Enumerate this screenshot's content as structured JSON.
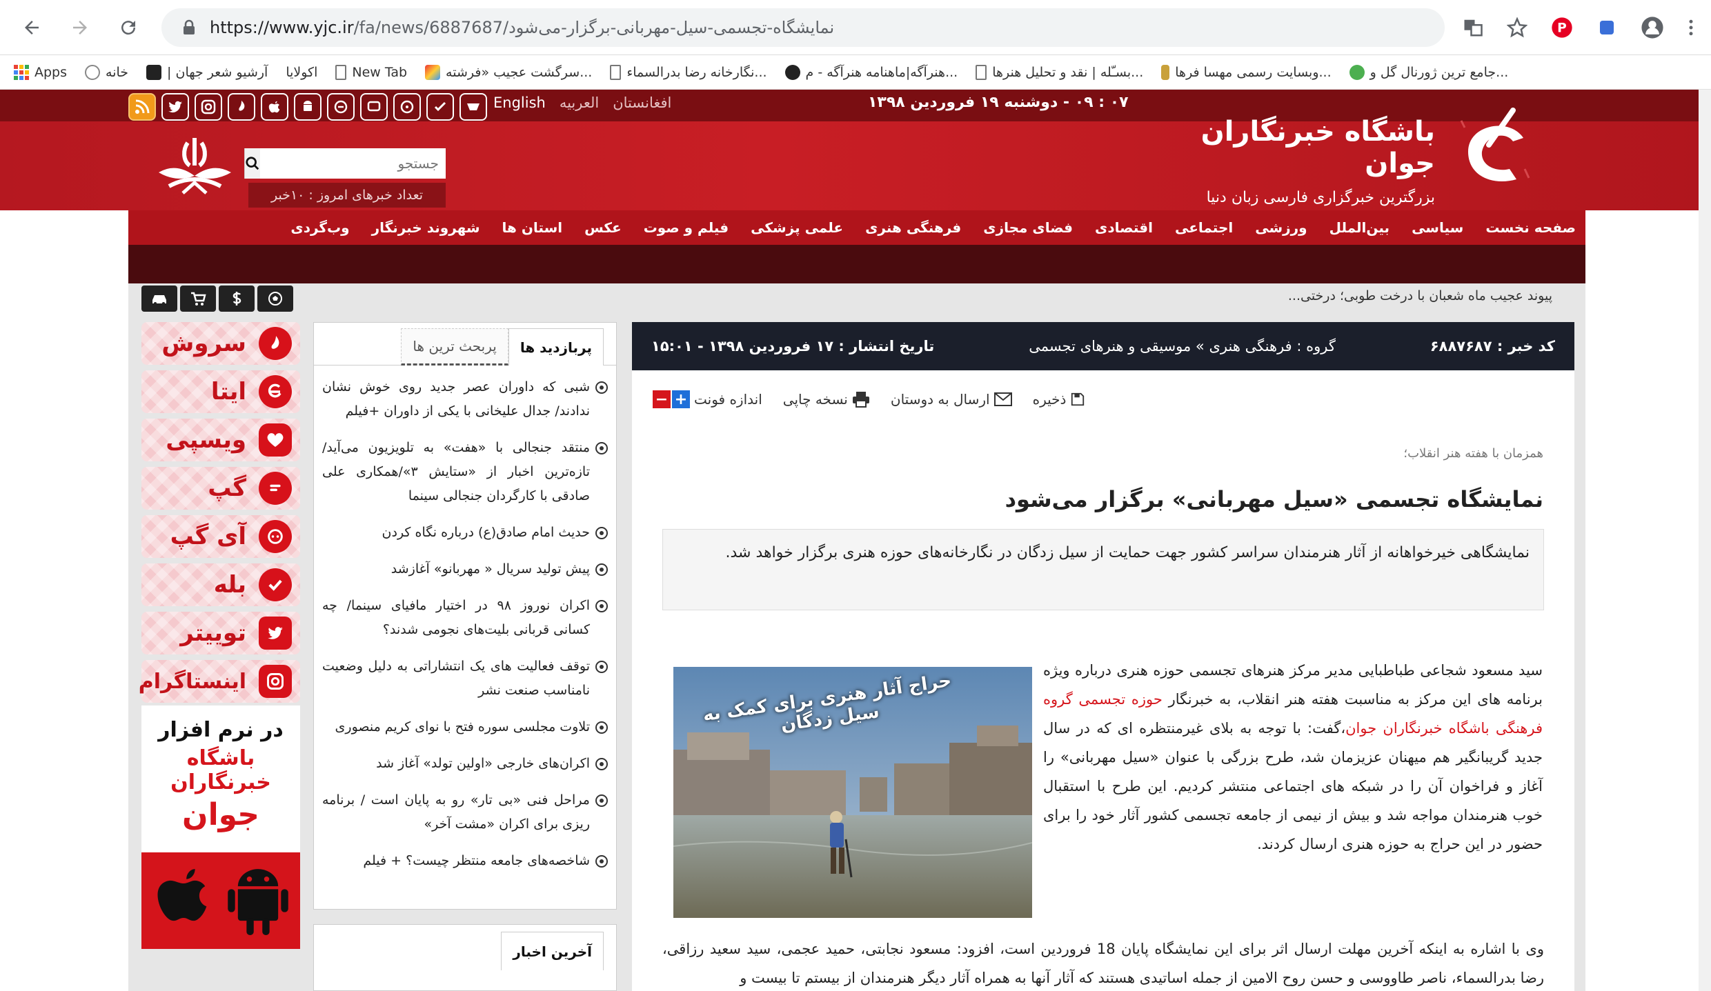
{
  "browser": {
    "url": "https://www.yjc.ir/fa/news/6887687/نمایشگاه-تجسمی-سیل-مهربانی-برگزار-می‌شود",
    "url_host": "https://www.yjc.ir",
    "url_path": "/fa/news/6887687/نمایشگاه-تجسمی-سیل-مهربانی-برگزار-می‌شود"
  },
  "bookmarks": [
    "Apps",
    "خانه",
    "| آرشیو شعر جهان",
    "اکولایا",
    "New Tab",
    "سرگشت عجیب «فرشته...",
    "نگارخانه رضا بدرالسماء...",
    "هنرآگه|ماهنامه هنرآگه - م...",
    "بسـّله | نقد و تحلیل هنرها...",
    "وبسایت رسمی مهسا فرها...",
    "جامع ترین ژورنال گل و..."
  ],
  "site": {
    "date": "۰۷ : ۰۹ - دوشنبه ۱۹ فروردین ۱۳۹۸",
    "langs": [
      "افغانستان",
      "العربیه",
      "English"
    ],
    "social": [
      "W",
      "E",
      "P",
      "E",
      "E",
      "A",
      "",
      "S",
      "",
      "T",
      "RSS"
    ],
    "title": "باشگاه خبرنگاران جوان",
    "slogan": "بزرگترین خبرگزاری فارسی زبان دنیا",
    "search_placeholder": "جستجو",
    "news_count": "تعداد خبرهای امروز : ۱۰خبر",
    "menu": [
      "صفحه نخست",
      "سیاسی",
      "بین‌الملل",
      "ورزشی",
      "اجتماعی",
      "اقتصادی",
      "فضای مجازی",
      "فرهنگی هنری",
      "علمی پزشکی",
      "فیلم و صوت",
      "عکس",
      "استان ها",
      "شهروند خبرنگار",
      "وب‌گردی"
    ],
    "ticker": "پیوند عجیب ماه شعبان با درخت طوبی؛ درختی..."
  },
  "article": {
    "code": "کد خبر : ۶۸۸۷۶۸۷",
    "group": "گروه : فرهنگی هنری » موسیقی و هنرهای تجسمی",
    "published": "تاریخ انتشار : ۱۷ فروردین ۱۳۹۸ - ۱۵:۰۱",
    "tools": {
      "save": "ذخیره",
      "send": "ارسال به دوستان",
      "print": "نسخه چاپی",
      "fontsize": "اندازه فونت",
      "minus": "−",
      "plus": "+"
    },
    "overline": "همزمان با هفته هنر انقلاب؛",
    "headline": "نمایشگاه تجسمی «سیل مهربانی» برگزار می‌شود",
    "lead": "نمایشگاهی خیرخواهانه از آثار هنرمندان سراسر کشور جهت حمایت از سیل زدگان در نگارخانه‌های حوزه هنری برگزار خواهد شد.",
    "photo_caption": "حراج آثار هنری برای کمک به سیل زدگان",
    "body1_a": "سید مسعود شجاعی طباطبایی مدیر مرکز هنرهای تجسمی حوزه هنری درباره ویژه برنامه های این مرکز به مناسبت هفته هنر انقلاب، به خبرنگار ",
    "body1_link": "حوزه تجسمی گروه فرهنگی باشگاه خبرنگاران جوان",
    "body1_b": "،گفت: با توجه به بلای غیرمنتظره ای که در سال جدید گریبانگیر هم میهنان عزیزمان شد، طرح بزرگی با عنوان «سیل مهربانی» را آغاز و فراخوان آن را در شبکه های اجتماعی منتشر کردیم. این طرح با استقبال خوب هنرمندان مواجه شد و بیش از نیمی از جامعه تجسمی کشور آثار خود را برای حضور در این حراج به حوزه هنری ارسال کردند.",
    "body2": "وی با اشاره به اینکه آخرین مهلت ارسال اثر برای این نمایشگاه پایان 18 فروردین است، افزود: مسعود نجابتی، حمید عجمی، سید سعید رزاقی، رضا بدرالسماء، ناصر طاووسی و حسن روح الامین از جمله اساتیدی هستند که آثار آنها به همراه آثار دیگر هنرمندان از بیستم تا بیست و"
  },
  "sidebar": {
    "tab_active": "پربازدید ها",
    "tab_inactive": "پربحث ترین ها",
    "items": [
      "شبی که داوران عصر جدید روی خوش نشان ندادند/ جدال علیخانی با یکی از داوران +فیلم",
      "منتقد جنجالی با «هفت» به تلویزیون می‌آید/ تازه‌ترین اخبار از «ستایش ۳»/همکاری علی صادقی با کارگردان جنجالی سینما",
      "حدیث امام صادق(ع) درباره نگاه کردن",
      "پیش تولید سریال « مهربانو» آغازشد",
      "اکران نوروز ۹۸ در اختیار مافیای سینما/ چه کسانی قربانی بلیت‌های نجومی شدند؟",
      "توقف فعالیت های یک انتشاراتی به دلیل وضعیت نامناسب صنعت نشر",
      "تلاوت مجلسی سوره فتح با نوای کریم منصوری",
      "اکران‌های خارجی «اولین تولد» آغاز شد",
      "مراحل فنی «بی تار» رو به پایان است / برنامه ریزی برای اکران «مشت آخر»",
      "شاخصه‌های جامعه منتظر چیست؟ + فیلم"
    ],
    "latest_tab": "آخرین اخبار"
  },
  "messengers": [
    {
      "label": "سروش",
      "icon": "soroush-icon"
    },
    {
      "label": "ایتا",
      "icon": "eitaa-icon"
    },
    {
      "label": "ویسپی",
      "icon": "wispi-icon"
    },
    {
      "label": "گپ",
      "icon": "gap-icon"
    },
    {
      "label": "آی گپ",
      "icon": "igap-icon"
    },
    {
      "label": "بله",
      "icon": "bale-icon"
    },
    {
      "label": "توییتر",
      "icon": "twitter-icon"
    },
    {
      "label": "اینستاگرام",
      "icon": "instagram-icon"
    }
  ],
  "appbox": {
    "line1": "در نرم افزار",
    "line2": "باشگاه خبرنگاران",
    "line3": "جوان"
  },
  "colors": {
    "brand_red": "#c81e25",
    "link_red": "#d5151c",
    "info_bar": "#1b1f2b"
  }
}
